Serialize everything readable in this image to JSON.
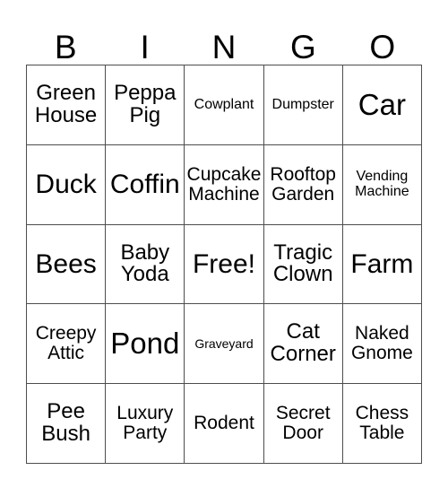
{
  "card": {
    "header": {
      "letters": [
        "B",
        "I",
        "N",
        "G",
        "O"
      ]
    },
    "rows": [
      [
        {
          "text": "Green House",
          "size": "md"
        },
        {
          "text": "Peppa Pig",
          "size": "md"
        },
        {
          "text": "Cowplant",
          "size": "xs"
        },
        {
          "text": "Dumpster",
          "size": "xs"
        },
        {
          "text": "Car",
          "size": "xl"
        }
      ],
      [
        {
          "text": "Duck",
          "size": "lg"
        },
        {
          "text": "Coffin",
          "size": "lg"
        },
        {
          "text": "Cupcake Machine",
          "size": "sm"
        },
        {
          "text": "Rooftop Garden",
          "size": "sm"
        },
        {
          "text": "Vending Machine",
          "size": "xs"
        }
      ],
      [
        {
          "text": "Bees",
          "size": "lg"
        },
        {
          "text": "Baby Yoda",
          "size": "md"
        },
        {
          "text": "Free!",
          "size": "lg"
        },
        {
          "text": "Tragic Clown",
          "size": "md"
        },
        {
          "text": "Farm",
          "size": "lg"
        }
      ],
      [
        {
          "text": "Creepy Attic",
          "size": "sm"
        },
        {
          "text": "Pond",
          "size": "xl"
        },
        {
          "text": "Graveyard",
          "size": "xxs"
        },
        {
          "text": "Cat Corner",
          "size": "md"
        },
        {
          "text": "Naked Gnome",
          "size": "sm"
        }
      ],
      [
        {
          "text": "Pee Bush",
          "size": "md"
        },
        {
          "text": "Luxury Party",
          "size": "sm"
        },
        {
          "text": "Rodent",
          "size": "sm"
        },
        {
          "text": "Secret Door",
          "size": "sm"
        },
        {
          "text": "Chess Table",
          "size": "sm"
        }
      ]
    ]
  },
  "colors": {
    "background": "#ffffff",
    "text": "#000000",
    "border": "#4d4d4d"
  }
}
